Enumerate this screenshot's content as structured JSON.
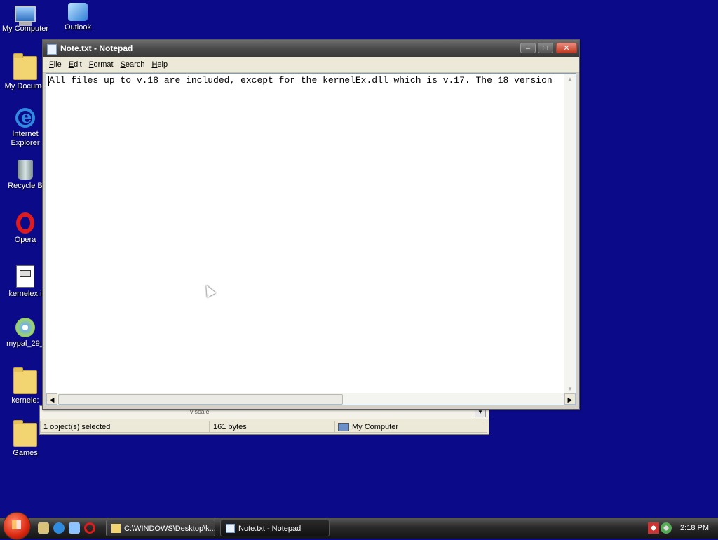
{
  "desktop": {
    "icons": [
      {
        "label": "My Computer",
        "icon": "computer-icon"
      },
      {
        "label": "Outlook",
        "icon": "outlook-icon"
      },
      {
        "label": "My Docume",
        "icon": "documents-folder-icon"
      },
      {
        "label": "Internet Explorer",
        "icon": "internet-explorer-icon"
      },
      {
        "label": "Recycle B",
        "icon": "recycle-bin-icon"
      },
      {
        "label": "Opera",
        "icon": "opera-icon"
      },
      {
        "label": "kernelex.i",
        "icon": "setup-file-icon"
      },
      {
        "label": "mypal_29_",
        "icon": "setup-cd-icon"
      },
      {
        "label": "kernele:",
        "icon": "folder-icon"
      },
      {
        "label": "Games",
        "icon": "folder-icon"
      }
    ]
  },
  "notepad": {
    "title": "Note.txt - Notepad",
    "buttons": {
      "minimize": "–",
      "maximize": "□",
      "close": "✕"
    },
    "menus": [
      "File",
      "Edit",
      "Format",
      "Search",
      "Help"
    ],
    "text_first": "A",
    "text_rest": "ll files up to v.18 are included, except for the kernelEx.dll which is v.17. The 18 version"
  },
  "explorer_behind": {
    "strip_text": "viscale",
    "status": {
      "selected": "1 object(s) selected",
      "size": "161 bytes",
      "location": "My Computer"
    }
  },
  "taskbar": {
    "tasks": [
      {
        "label": "C:\\WINDOWS\\Desktop\\k...",
        "active": false
      },
      {
        "label": "Note.txt - Notepad",
        "active": true
      }
    ],
    "clock": "2:18 PM"
  },
  "colors": {
    "desktop": "#0b0b8a",
    "titlebar": "#4a4a4a"
  }
}
